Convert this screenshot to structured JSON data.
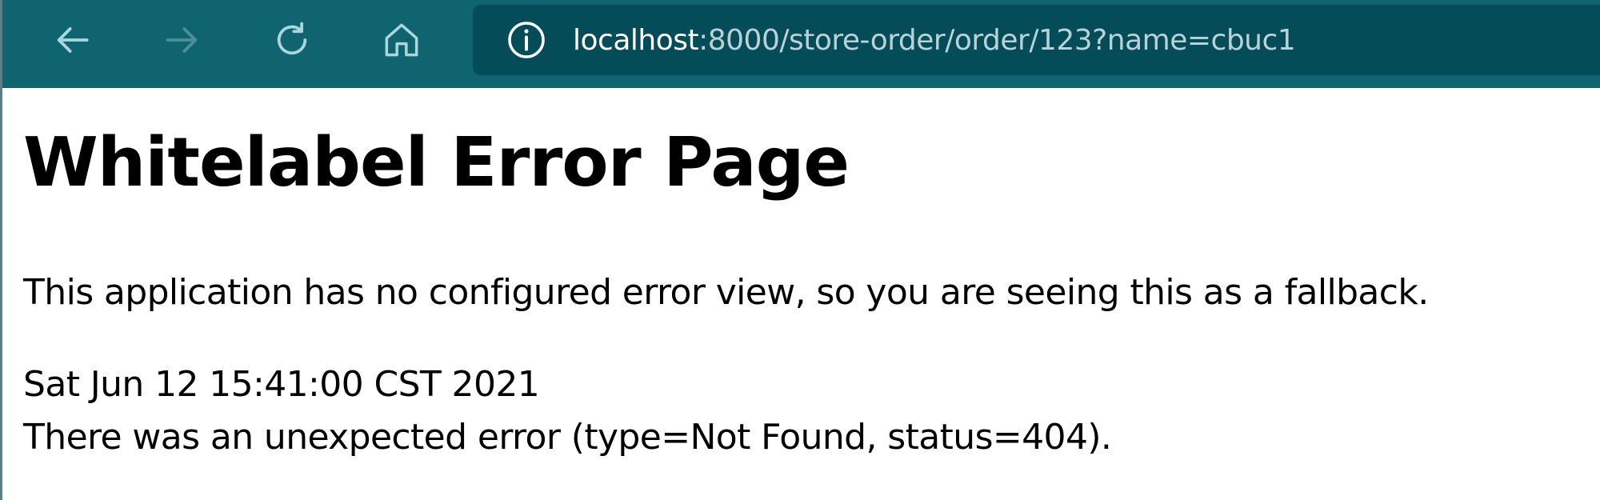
{
  "browser": {
    "url_host": "localhost",
    "url_rest": ":8000/store-order/order/123?name=cbuc1",
    "icons": {
      "back": "arrow-left-icon",
      "forward": "arrow-right-icon",
      "reload": "reload-icon",
      "home": "home-icon",
      "site_info": "info-circle-icon"
    },
    "colors": {
      "toolbar": "#0f6470",
      "address_bar": "#054c59",
      "icon_active": "#a9d7dd",
      "icon_disabled": "#4d8f99"
    },
    "forward_enabled": false
  },
  "page": {
    "title": "Whitelabel Error Page",
    "message": "This application has no configured error view, so you are seeing this as a fallback.",
    "timestamp": "Sat Jun 12 15:41:00 CST 2021",
    "error_detail": "There was an unexpected error (type=Not Found, status=404)."
  }
}
